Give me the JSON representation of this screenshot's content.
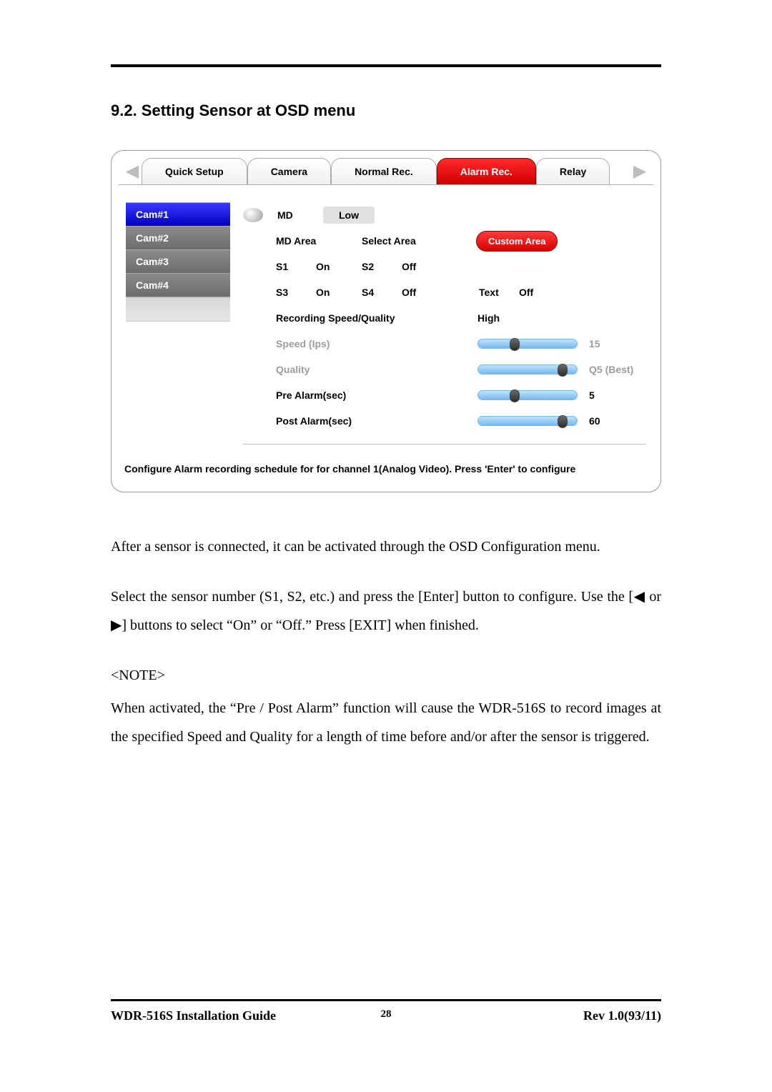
{
  "heading": "9.2.  Setting Sensor at OSD menu",
  "tabs": {
    "items": [
      "Quick Setup",
      "Camera",
      "Normal Rec.",
      "Alarm Rec.",
      "Relay"
    ],
    "active_index": 3
  },
  "cameras": [
    "Cam#1",
    "Cam#2",
    "Cam#3",
    "Cam#4"
  ],
  "camera_selected_index": 0,
  "settings": {
    "md_label": "MD",
    "md_value": "Low",
    "md_area_label": "MD Area",
    "select_area_label": "Select Area",
    "custom_area_btn": "Custom Area",
    "sensors": [
      {
        "name": "S1",
        "value": "On"
      },
      {
        "name": "S2",
        "value": "Off"
      },
      {
        "name": "S3",
        "value": "On"
      },
      {
        "name": "S4",
        "value": "Off"
      }
    ],
    "text_label": "Text",
    "text_value": "Off",
    "rsq_label": "Recording Speed/Quality",
    "rsq_value": "High",
    "speed_label": "Speed (Ips)",
    "speed_value": "15",
    "speed_pct": 35,
    "quality_label": "Quality",
    "quality_value": "Q5 (Best)",
    "quality_pct": 88,
    "pre_label": "Pre Alarm(sec)",
    "pre_value": "5",
    "pre_pct": 35,
    "post_label": "Post Alarm(sec)",
    "post_value": "60",
    "post_pct": 88
  },
  "status_text": "Configure Alarm recording schedule for for channel 1(Analog Video). Press 'Enter' to configure",
  "body": {
    "p1": "After a sensor is connected, it can be activated through the OSD Configuration menu.",
    "p2": "Select the sensor number (S1, S2, etc.) and press the [Enter] button to configure. Use the [◀ or ▶] buttons to select “On” or “Off.” Press [EXIT] when finished.",
    "note_label": "<NOTE>",
    "p3": "When activated, the “Pre / Post Alarm” function will cause the WDR-516S to record images at the specified Speed and Quality for a length of time before and/or after the sensor is triggered."
  },
  "footer": {
    "left": "WDR-516S  Installation  Guide",
    "center": "28",
    "right": "Rev  1.0(93/11)"
  }
}
